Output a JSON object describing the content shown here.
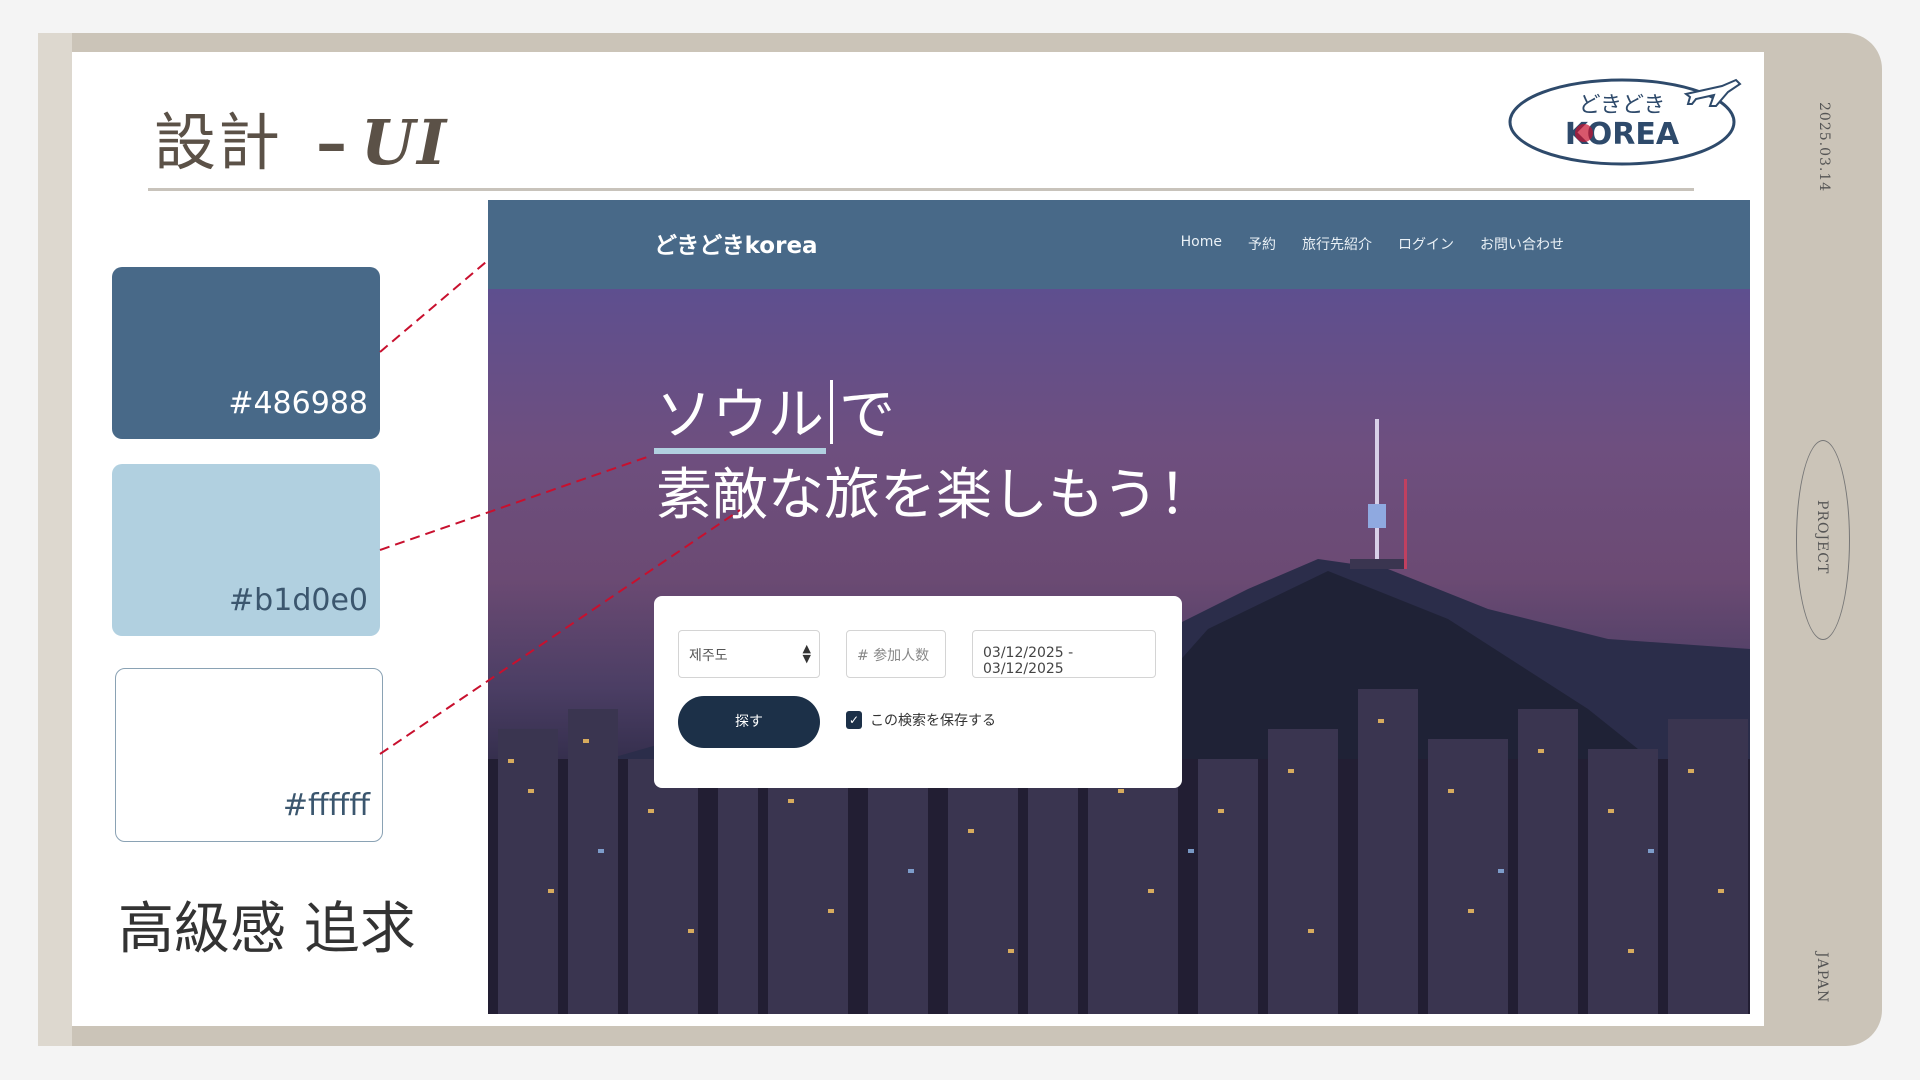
{
  "slide": {
    "title_main": "設計",
    "title_dash": "–",
    "title_suffix": "UI",
    "date": "2025.03.14",
    "side_project": "PROJECT",
    "side_japan": "JAPAN",
    "tagline": "高級感 追求"
  },
  "logo": {
    "line1": "どきどき",
    "line2": "KOREA",
    "icon": "airplane-icon"
  },
  "swatches": [
    {
      "hex_label": "#486988",
      "color": "#486988"
    },
    {
      "hex_label": "#b1d0e0",
      "color": "#b1d0e0"
    },
    {
      "hex_label": "#ffffff",
      "color": "#ffffff"
    }
  ],
  "colors": {
    "frame": "#cbc4b8",
    "connector": "#c8102e",
    "nav_bg": "#486988",
    "button": "#1c3048"
  },
  "mockup": {
    "brand": "どきどきkorea",
    "nav": [
      "Home",
      "予約",
      "旅行先紹介",
      "ログイン",
      "お問い合わせ"
    ],
    "hero_line1_word": "ソウル",
    "hero_line1_tail": "で",
    "hero_line2": "素敵な旅を楽しもう！",
    "search": {
      "region_value": "제주도",
      "people_placeholder": "# 参加人数",
      "date_value": "03/12/2025 - 03/12/2025",
      "button_label": "探す",
      "save_checked": true,
      "save_label": "この検索を保存する"
    }
  }
}
